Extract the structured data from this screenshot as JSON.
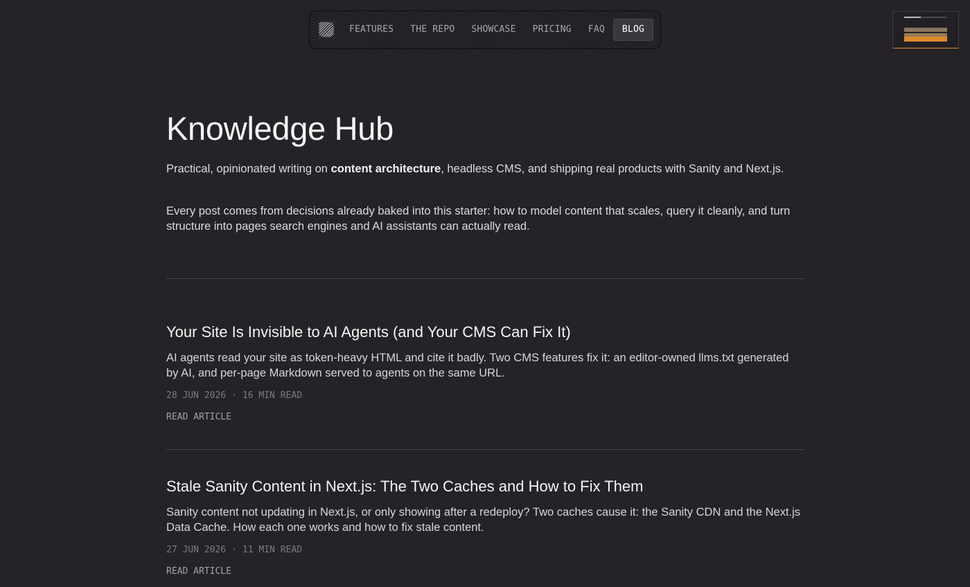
{
  "nav": {
    "logo": "diagonal-lines-logo",
    "items": [
      {
        "label": "FEATURES"
      },
      {
        "label": "THE REPO"
      },
      {
        "label": "SHOWCASE"
      },
      {
        "label": "PRICING"
      },
      {
        "label": "FAQ"
      },
      {
        "label": "BLOG",
        "active": true
      }
    ]
  },
  "minimap": {
    "accent": "#e08a2c"
  },
  "hero": {
    "title": "Knowledge Hub",
    "intro_1_before": "Practical, opinionated writing on ",
    "intro_1_bold": "content architecture",
    "intro_1_after": ", headless CMS, and shipping real products with Sanity and Next.js.",
    "intro_2": "Every post comes from decisions already baked into this starter: how to model content that scales, query it cleanly, and turn structure into pages search engines and AI assistants can actually read."
  },
  "posts": [
    {
      "title": "Your Site Is Invisible to AI Agents (and Your CMS Can Fix It)",
      "excerpt": "AI agents read your site as token-heavy HTML and cite it badly. Two CMS features fix it: an editor-owned llms.txt generated by AI, and per-page Markdown served to agents on the same URL.",
      "date": "28 JUN 2026",
      "separator": "·",
      "read_time": "16 MIN READ",
      "cta": "READ ARTICLE"
    },
    {
      "title": "Stale Sanity Content in Next.js: The Two Caches and How to Fix Them",
      "excerpt": "Sanity content not updating in Next.js, or only showing after a redeploy? Two caches cause it: the Sanity CDN and the Next.js Data Cache. How each one works and how to fix stale content.",
      "date": "27 JUN 2026",
      "separator": "·",
      "read_time": "11 MIN READ",
      "cta": "READ ARTICLE"
    }
  ]
}
